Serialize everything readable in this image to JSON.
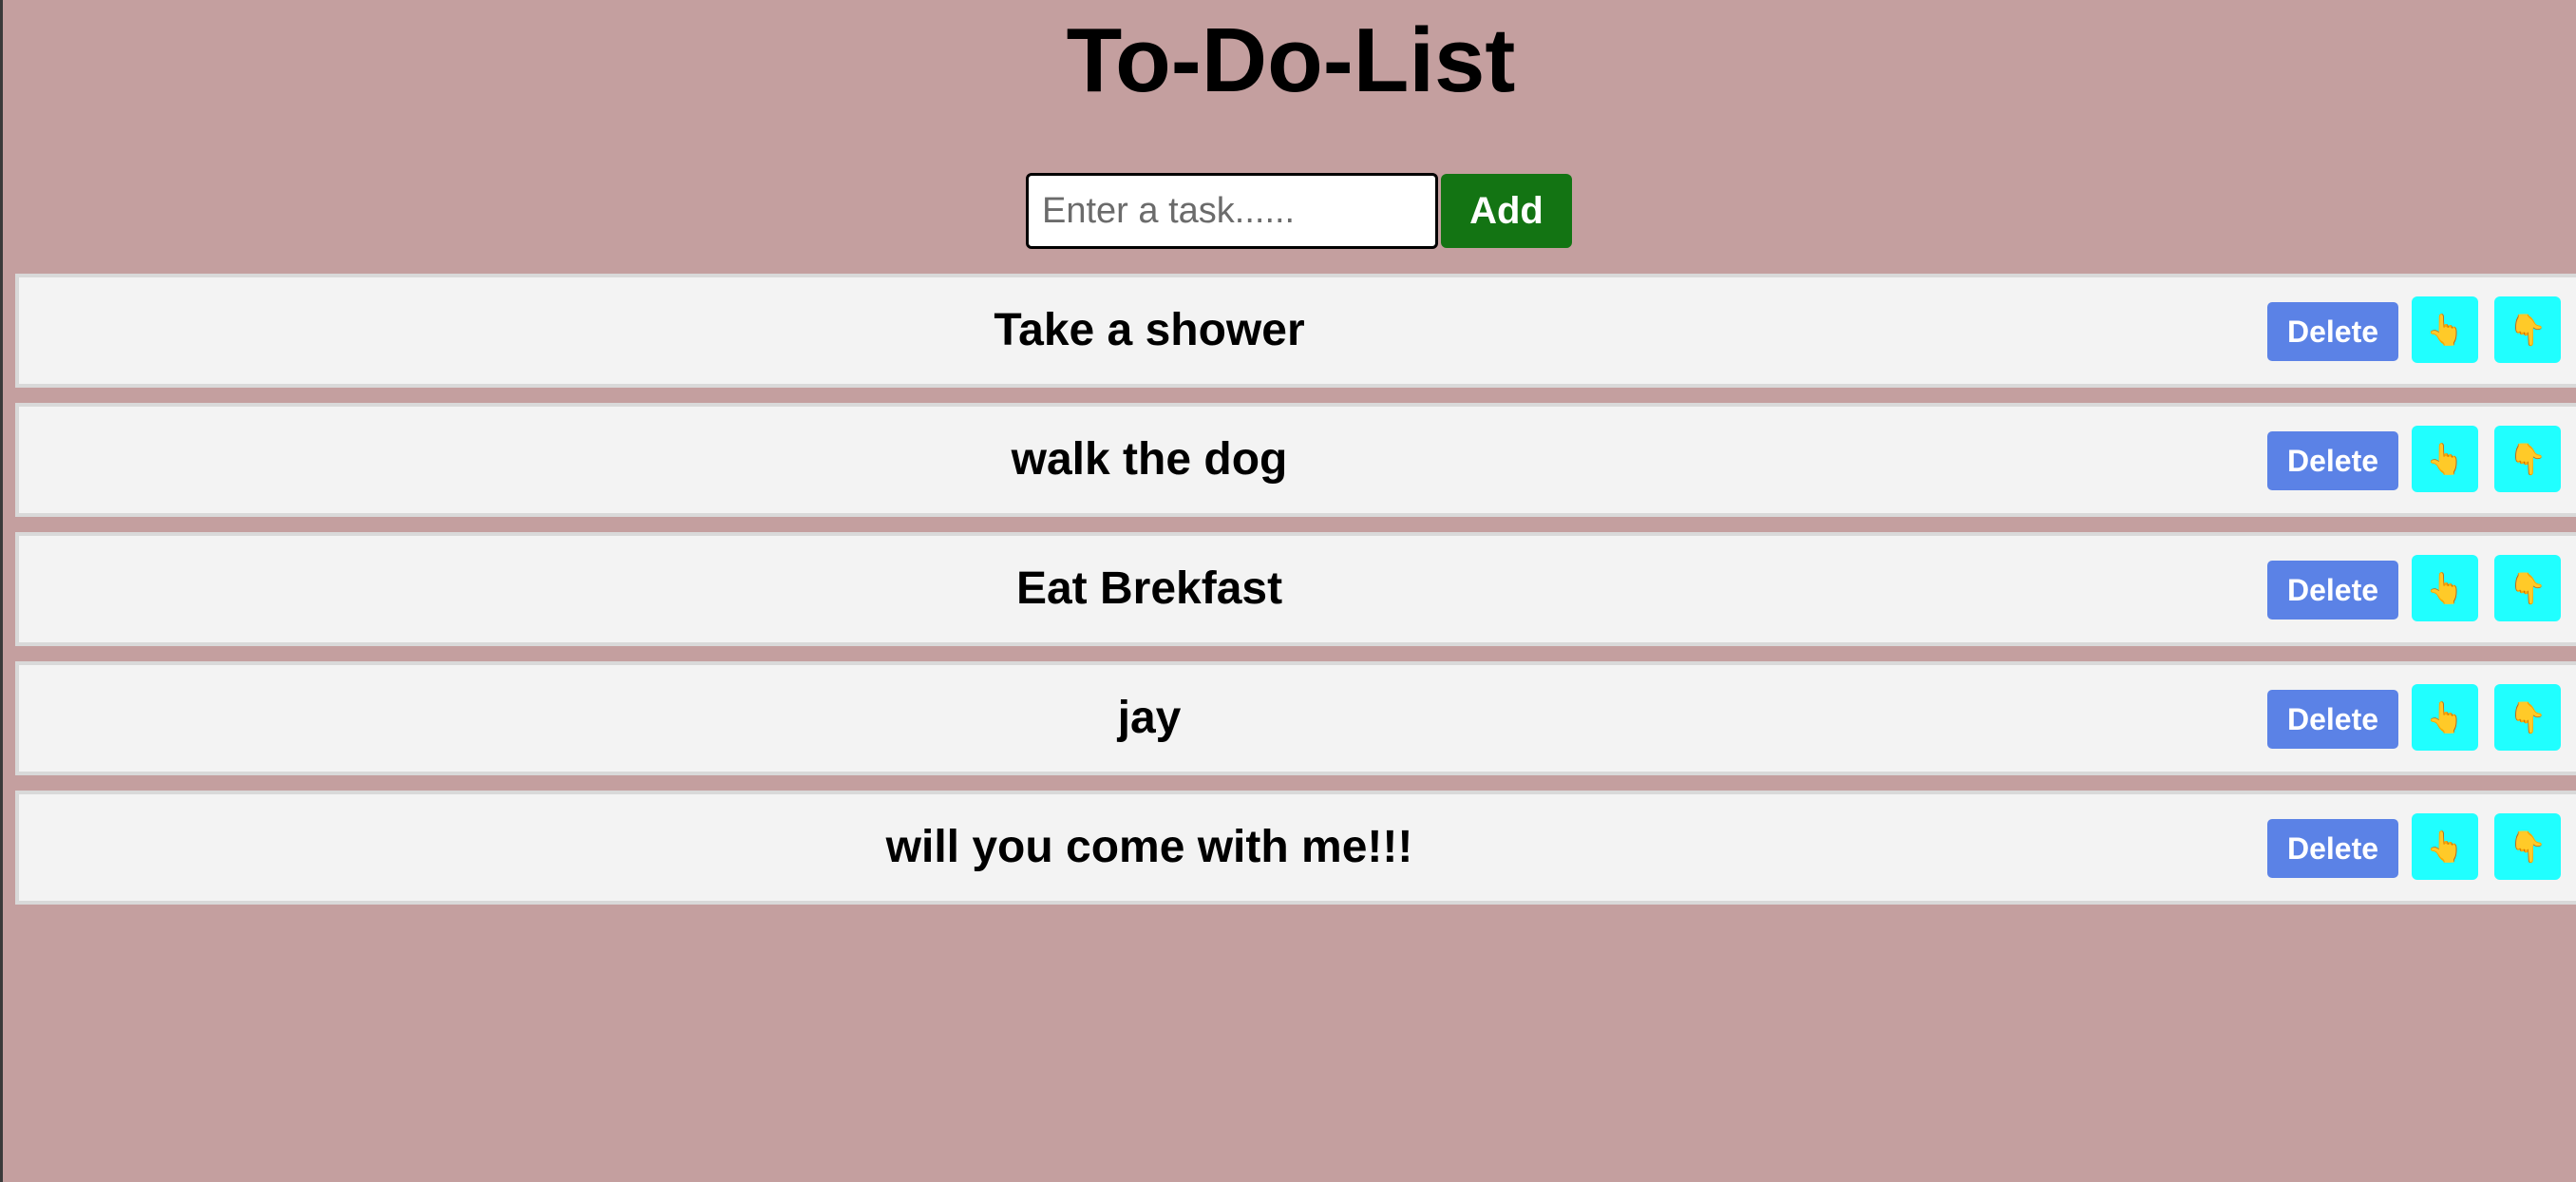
{
  "app": {
    "title": "To-Do-List"
  },
  "input": {
    "placeholder": "Enter a task......",
    "value": "",
    "add_label": "Add"
  },
  "tasks": [
    {
      "text": "Take a shower",
      "delete_label": "Delete",
      "up_icon": "👆",
      "down_icon": "👇"
    },
    {
      "text": "walk the dog",
      "delete_label": "Delete",
      "up_icon": "👆",
      "down_icon": "👇"
    },
    {
      "text": "Eat Brekfast",
      "delete_label": "Delete",
      "up_icon": "👆",
      "down_icon": "👇"
    },
    {
      "text": "jay",
      "delete_label": "Delete",
      "up_icon": "👆",
      "down_icon": "👇"
    },
    {
      "text": "will you come with me!!!",
      "delete_label": "Delete",
      "up_icon": "👆",
      "down_icon": "👇"
    }
  ],
  "colors": {
    "background": "#c49f9f",
    "add_button": "#137413",
    "delete_button": "#5b82e6",
    "move_button": "#20ffff",
    "task_row": "#f3f3f3"
  }
}
